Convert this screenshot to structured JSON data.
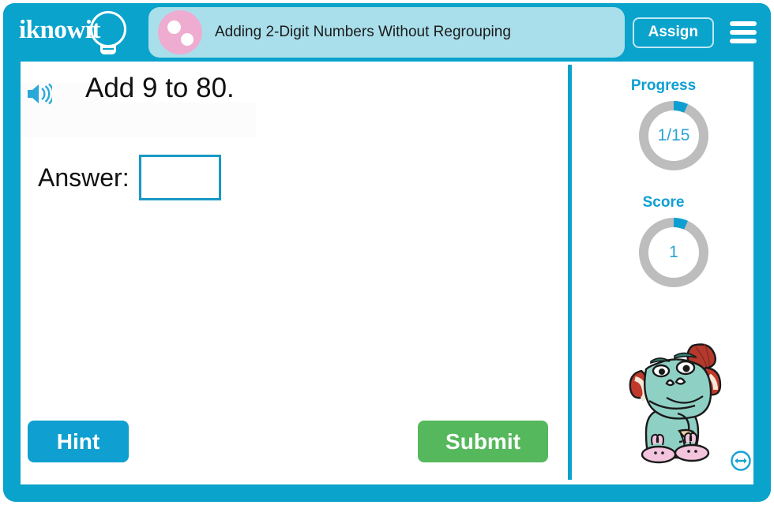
{
  "header": {
    "logo_text": "iknowit",
    "logo_icon": "lightbulb-icon",
    "subject_icon": "pink-circle-two-dots-icon",
    "lesson_title": "Adding 2-Digit Numbers Without Regrouping",
    "assign_label": "Assign",
    "menu_icon": "hamburger-menu-icon",
    "background_color": "#0aa3cc",
    "title_pill_color": "#a9dfeb"
  },
  "question": {
    "speaker_icon": "speaker-sound-icon",
    "text": "Add 9 to 80.",
    "answer_label": "Answer:",
    "answer_value": "",
    "answer_placeholder": ""
  },
  "actions": {
    "hint_label": "Hint",
    "hint_color": "#0f9fd0",
    "submit_label": "Submit",
    "submit_color": "#55b85c"
  },
  "panel": {
    "progress": {
      "label": "Progress",
      "value_text": "1/15",
      "current": 1,
      "total": 15,
      "percent": 6.7,
      "arc_color": "#0e9fd2",
      "track_color": "#bdbdbd"
    },
    "score": {
      "label": "Score",
      "value_text": "1",
      "current": 1,
      "percent": 6.7,
      "arc_color": "#0e9fd2",
      "track_color": "#bdbdbd"
    },
    "mascot": {
      "name": "teal-monster-mascot",
      "body_color": "#8fd0c4",
      "horn_color": "#c0392b",
      "cap_color": "#b5392d",
      "slipper_color": "#f2c4dd"
    },
    "resize_icon": "resize-horizontal-icon"
  }
}
